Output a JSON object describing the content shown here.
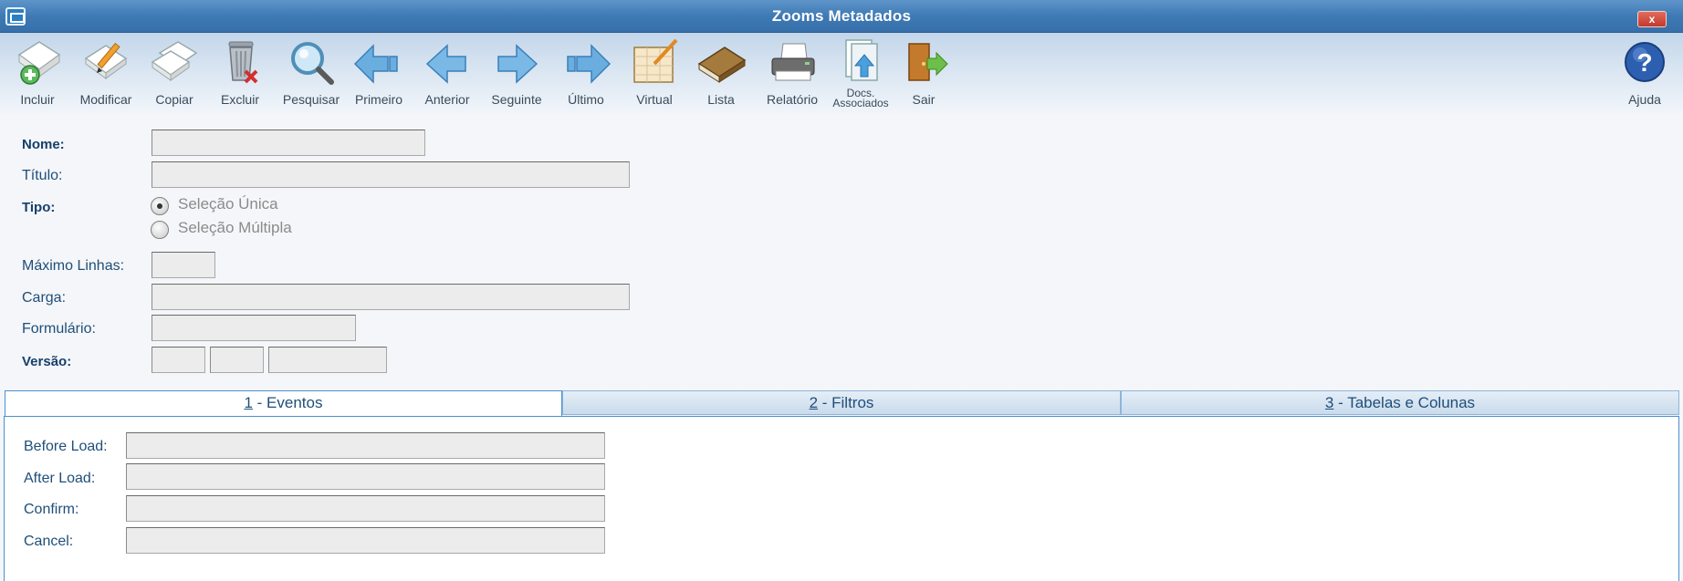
{
  "window": {
    "title": "Zooms Metadados",
    "close_label": "x"
  },
  "toolbar": {
    "incluir": "Incluir",
    "modificar": "Modificar",
    "copiar": "Copiar",
    "excluir": "Excluir",
    "pesquisar": "Pesquisar",
    "primeiro": "Primeiro",
    "anterior": "Anterior",
    "seguinte": "Seguinte",
    "ultimo": "Último",
    "virtual": "Virtual",
    "lista": "Lista",
    "relatorio": "Relatório",
    "docs_line1": "Docs.",
    "docs_line2": "Associados",
    "sair": "Sair",
    "ajuda": "Ajuda"
  },
  "form": {
    "nome_label": "Nome:",
    "titulo_label": "Título:",
    "tipo_label": "Tipo:",
    "tipo_options": [
      "Seleção Única",
      "Seleção Múltipla"
    ],
    "tipo_selected": "Seleção Única",
    "max_linhas_label": "Máximo Linhas:",
    "carga_label": "Carga:",
    "formulario_label": "Formulário:",
    "versao_label": "Versão:"
  },
  "tabs": [
    {
      "num": "1",
      "rest": " - Eventos",
      "active": true
    },
    {
      "num": "2",
      "rest": " - Filtros",
      "active": false
    },
    {
      "num": "3",
      "rest": " - Tabelas e Colunas",
      "active": false
    }
  ],
  "eventos": {
    "before_load_label": "Before Load:",
    "after_load_label": "After Load:",
    "confirm_label": "Confirm:",
    "cancel_label": "Cancel:"
  },
  "colors": {
    "titlebar": "#3f7ab5",
    "label_text": "#1f4e79",
    "tab_border": "#4a90d0",
    "input_bg": "#ececec"
  }
}
